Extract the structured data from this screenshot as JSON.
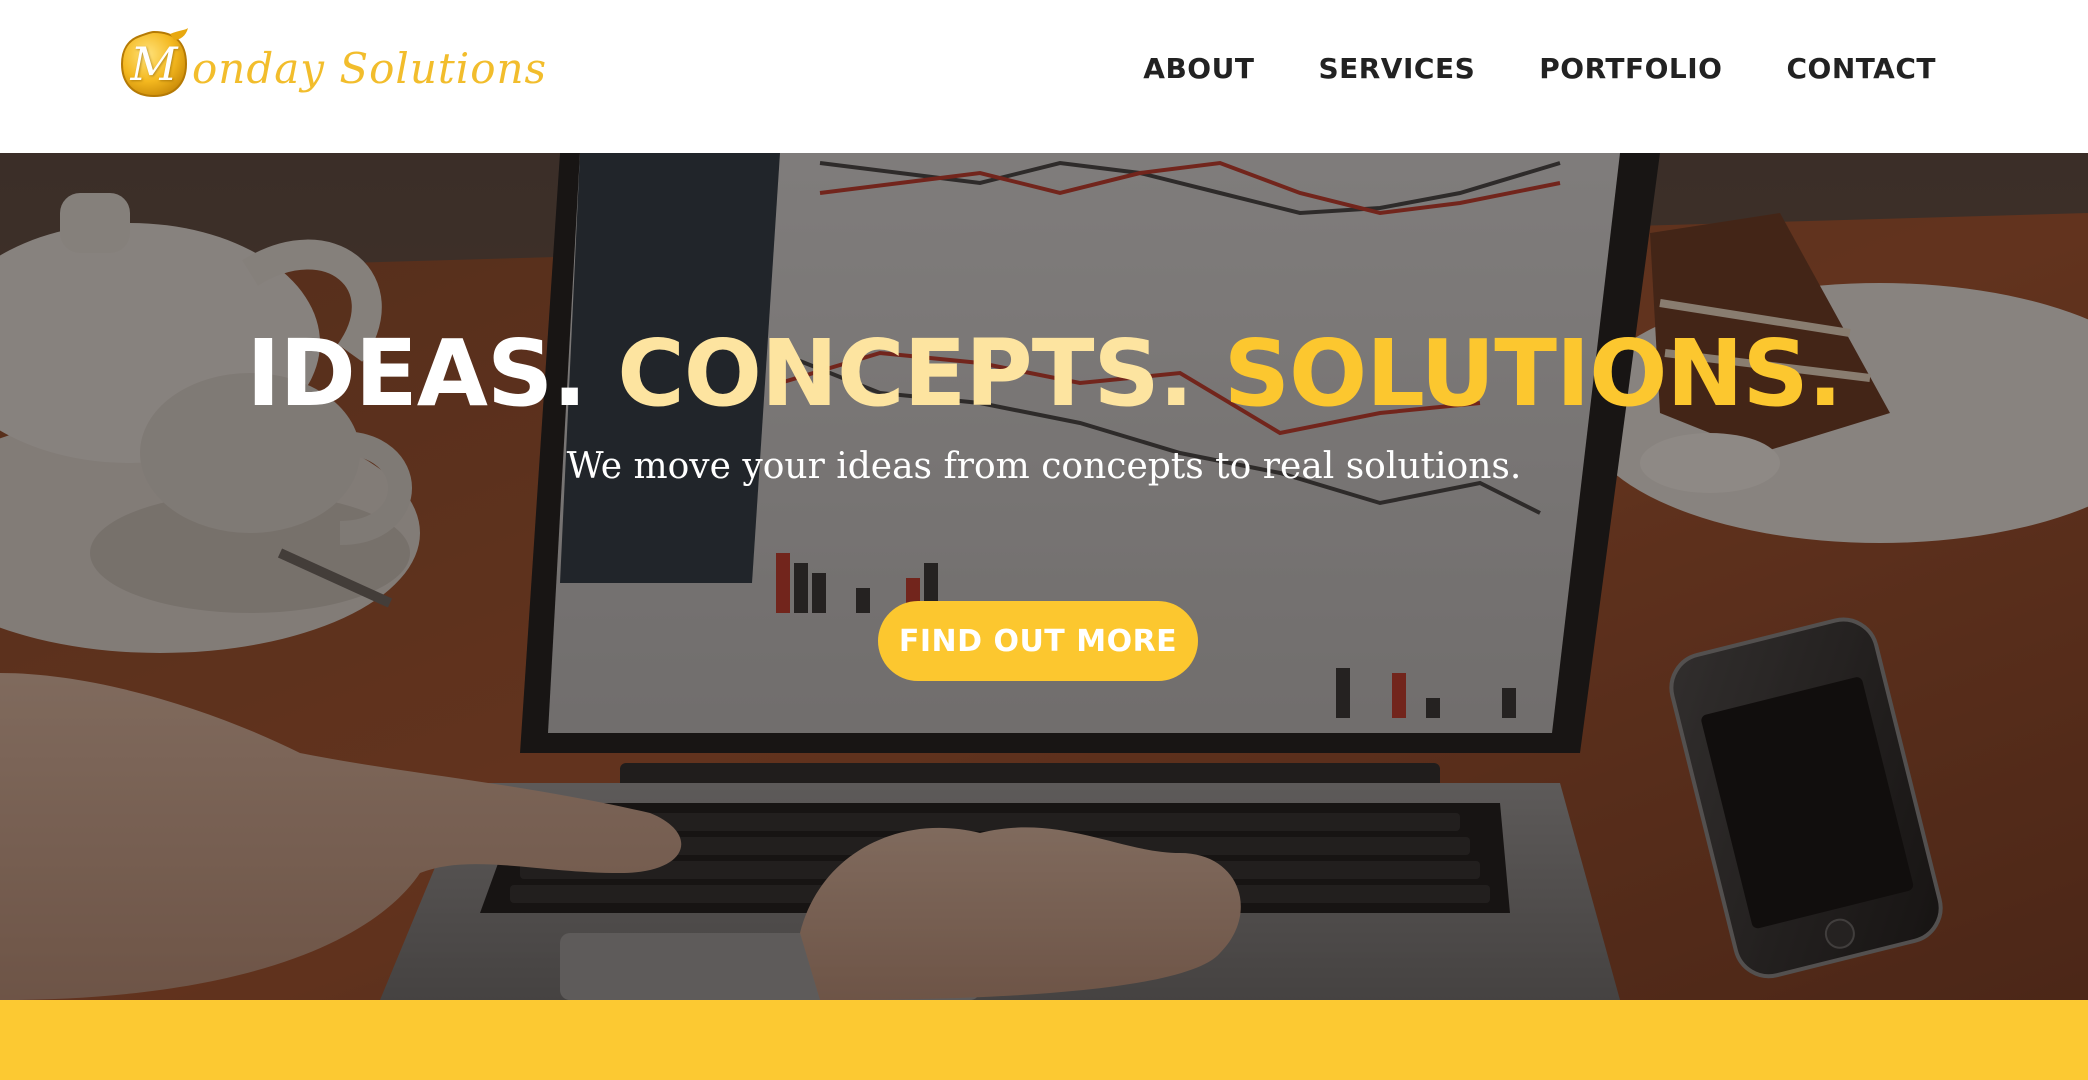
{
  "brand": {
    "name_initial": "M",
    "name_rest": "onday Solutions",
    "logo_icon": "leaf-badge-icon",
    "color": "#f2bd2c"
  },
  "nav": {
    "items": [
      {
        "label": "ABOUT"
      },
      {
        "label": "SERVICES"
      },
      {
        "label": "PORTFOLIO"
      },
      {
        "label": "CONTACT"
      }
    ]
  },
  "hero": {
    "heading_part1": "IDEAS.",
    "heading_part2": "CONCEPTS.",
    "heading_part3": "SOLUTIONS.",
    "subheading": "We move your ideas from concepts to real solutions.",
    "cta_label": "FIND OUT MORE",
    "background": "laptop-on-cafe-table-photo"
  },
  "colors": {
    "accent": "#fcc72f",
    "accent_light": "#fde4a0",
    "nav_text": "#222222"
  }
}
